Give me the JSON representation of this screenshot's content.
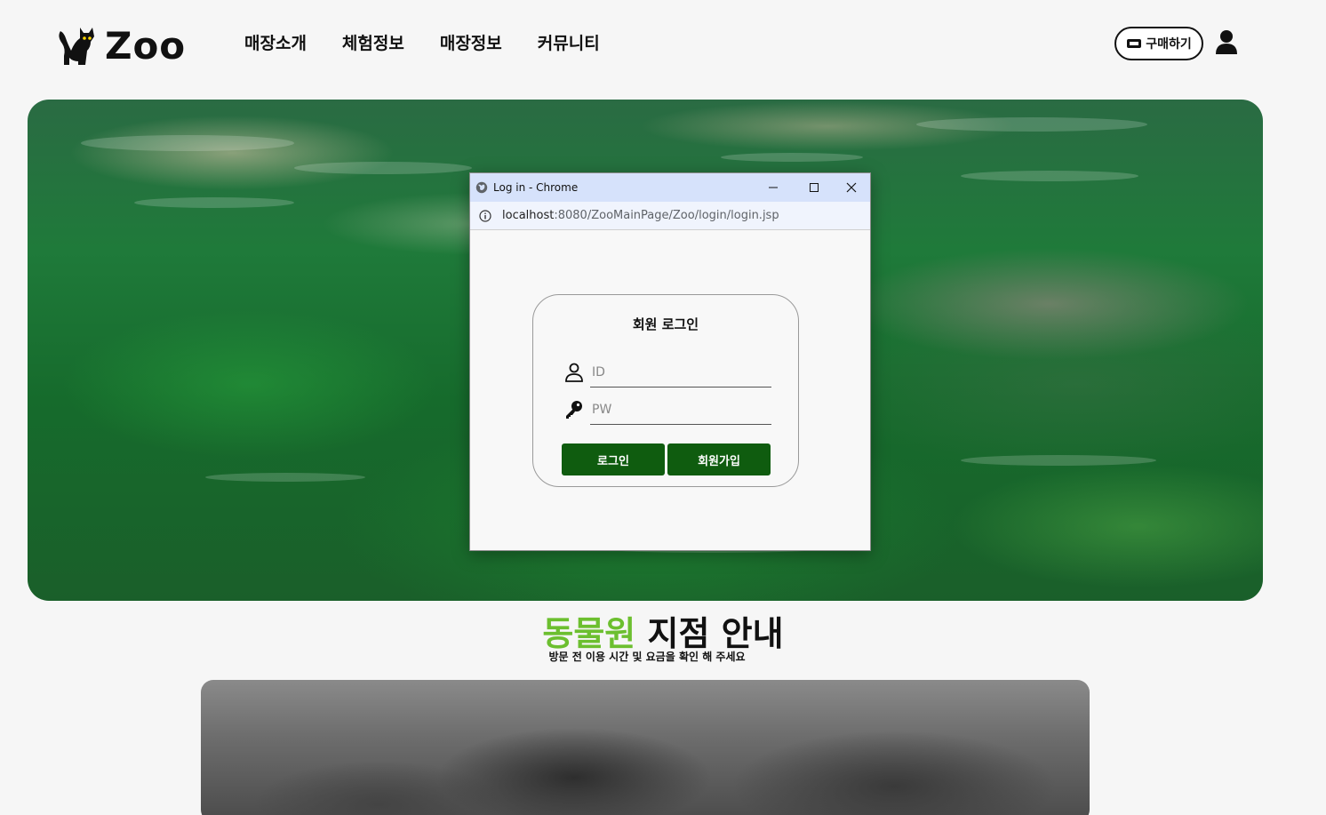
{
  "header": {
    "logo_text": "Zoo",
    "nav": [
      "매장소개",
      "체험정보",
      "매장정보",
      "커뮤니티"
    ],
    "buy_label": "구매하기"
  },
  "section": {
    "title_green": "동물원",
    "title_rest": " 지점 안내",
    "subtitle": "방문 전 이용 시간 및 요금을 확인 해 주세요"
  },
  "popup": {
    "window_title": "Log in - Chrome",
    "url_host": "localhost",
    "url_path": ":8080/ZooMainPage/Zoo/login/login.jsp",
    "login_title": "회원 로그인",
    "id_placeholder": "ID",
    "pw_placeholder": "PW",
    "login_button": "로그인",
    "join_button": "회원가입"
  },
  "colors": {
    "accent_green": "#6cbf2f",
    "button_green": "#0f5c0f"
  }
}
